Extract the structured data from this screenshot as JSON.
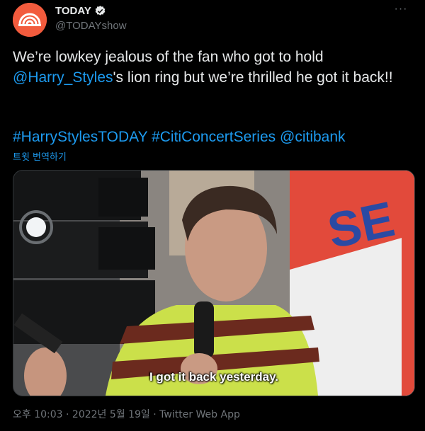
{
  "tweet": {
    "display_name": "TODAY",
    "handle": "@TODAYshow",
    "more_label": "···",
    "text_part1": "We’re lowkey jealous of the fan who got to hold ",
    "mention": "@Harry_Styles",
    "text_part2": "'s lion ring but we’re thrilled he got it back!!",
    "hashtags": [
      "#HarryStylesTODAY",
      "#CitiConcertSeries",
      "@citibank"
    ],
    "translate_label": "트윗 번역하기",
    "media_subtitle": "I got it back yesterday.",
    "timestamp": "오후 10:03 · 2022년 5월 19일 · Twitter Web App"
  },
  "colors": {
    "background": "#000000",
    "text": "#e7e9ea",
    "secondary": "#71767b",
    "link": "#1d9bf0",
    "avatar": "#f25b3d"
  }
}
